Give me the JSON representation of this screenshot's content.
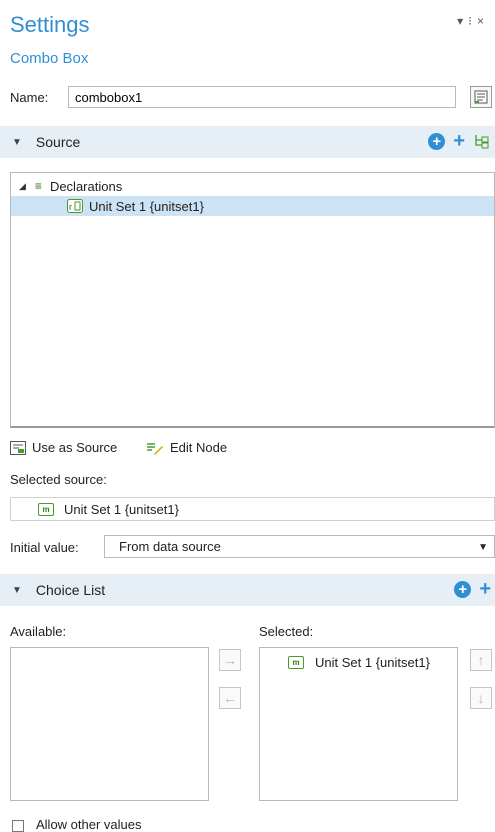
{
  "header": {
    "title": "Settings",
    "subtitle": "Combo Box",
    "window_controls": "▾ ⁝ ×"
  },
  "name_field": {
    "label": "Name:",
    "value": "combobox1"
  },
  "source_section": {
    "title": "Source",
    "tree": {
      "root_label": "Declarations",
      "child_label": "Unit Set 1 {unitset1}"
    },
    "use_as_source_label": "Use as Source",
    "edit_node_label": "Edit Node",
    "selected_source_label": "Selected source:",
    "selected_source_value": "Unit Set 1 {unitset1}",
    "initial_value_label": "Initial value:",
    "initial_value_selected": "From data source"
  },
  "choice_list_section": {
    "title": "Choice List",
    "available_label": "Available:",
    "selected_label": "Selected:",
    "selected_items": [
      "Unit Set 1 {unitset1}"
    ],
    "allow_other_values_label": "Allow other values",
    "allow_other_values_checked": false
  },
  "colors": {
    "accent": "#2f8fd5",
    "section_bg": "#e6eef6",
    "selection_bg": "#cce3f5",
    "icon_green": "#4a9b2c"
  }
}
